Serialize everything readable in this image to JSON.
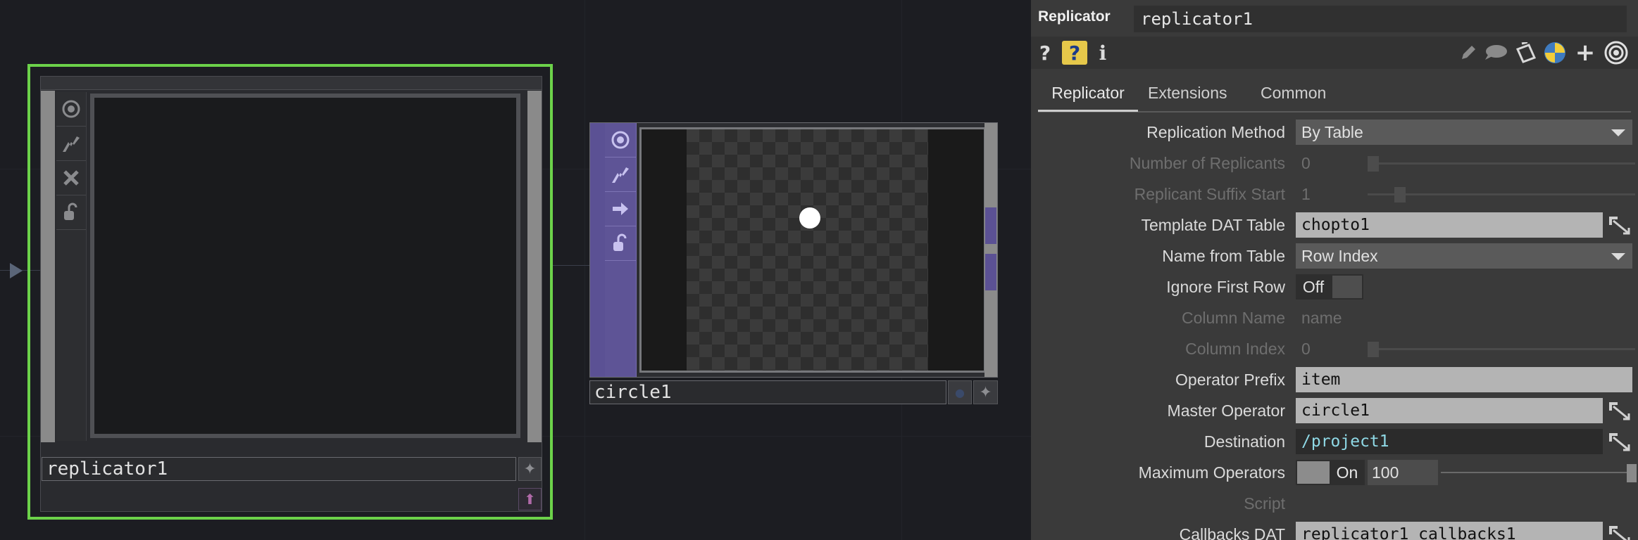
{
  "network": {
    "replicator_node": {
      "name": "replicator1"
    },
    "circle_node": {
      "name": "circle1"
    }
  },
  "panel": {
    "op_type": "Replicator",
    "op_name": "replicator1",
    "tabs": [
      "Replicator",
      "Extensions",
      "Common"
    ],
    "params": {
      "replication_method": {
        "label": "Replication Method",
        "value": "By Table"
      },
      "num_replicants": {
        "label": "Number of Replicants",
        "value": "0"
      },
      "suffix_start": {
        "label": "Replicant Suffix Start",
        "value": "1"
      },
      "template_table": {
        "label": "Template DAT Table",
        "value": "chopto1"
      },
      "name_from_table": {
        "label": "Name from Table",
        "value": "Row Index"
      },
      "ignore_first_row": {
        "label": "Ignore First Row",
        "value": "Off"
      },
      "column_name": {
        "label": "Column Name",
        "value": "name"
      },
      "column_index": {
        "label": "Column Index",
        "value": "0"
      },
      "operator_prefix": {
        "label": "Operator Prefix",
        "value": "item"
      },
      "master_operator": {
        "label": "Master Operator",
        "value": "circle1"
      },
      "destination": {
        "label": "Destination",
        "value": "/project1"
      },
      "max_operators": {
        "label": "Maximum Operators",
        "toggle": "On",
        "value": "100"
      },
      "script": {
        "label": "Script"
      },
      "callbacks_dat": {
        "label": "Callbacks DAT",
        "value": "replicator1_callbacks1"
      }
    }
  },
  "colors": {
    "selection": "#6cd24a",
    "top_purple": "#5b5194",
    "panel_bg": "#3a3a3a",
    "network_bg": "#1c1d22"
  },
  "icons": {
    "node": [
      "viewer-icon",
      "cook-icon",
      "bypass-icon",
      "lock-icon"
    ],
    "circle_node": [
      "viewer-icon",
      "cook-icon",
      "export-icon",
      "lock-icon"
    ],
    "panel_header": [
      "help-icon",
      "python-help-icon",
      "info-icon",
      "edit-icon",
      "comment-icon",
      "clone-icon",
      "python-icon",
      "add-icon",
      "viewer-target-icon"
    ]
  }
}
